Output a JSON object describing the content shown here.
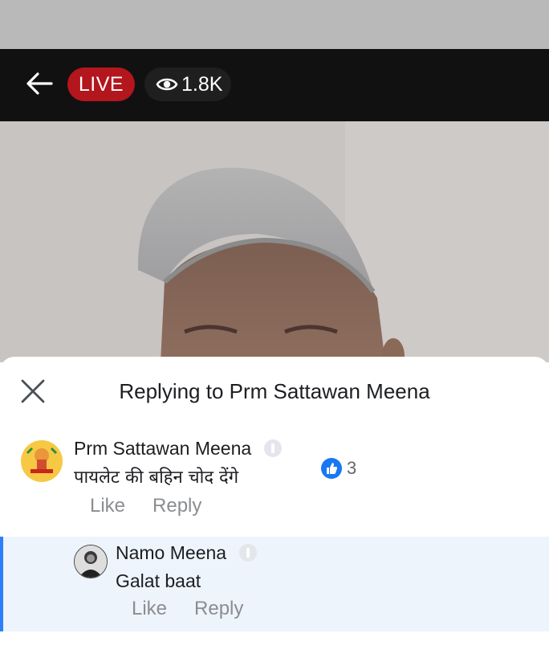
{
  "topbar": {
    "live_label": "LIVE",
    "viewer_count": "1.8K",
    "back_icon": "arrow-left-icon",
    "eye_icon": "eye-icon"
  },
  "sheet": {
    "title": "Replying to Prm Sattawan Meena",
    "close_icon": "close-icon"
  },
  "comment": {
    "author": "Prm Sattawan Meena",
    "text": "पायलेट की बहिन चोद देंगे",
    "reaction_count": "3",
    "like_label": "Like",
    "reply_label": "Reply"
  },
  "reply": {
    "author": "Namo Meena",
    "text": "Galat baat",
    "like_label": "Like",
    "reply_label": "Reply"
  },
  "colors": {
    "live_red": "#b3161d",
    "reply_accent": "#2d7ff9",
    "reaction_blue": "#1877f2",
    "reply_background": "#eef4fc"
  }
}
